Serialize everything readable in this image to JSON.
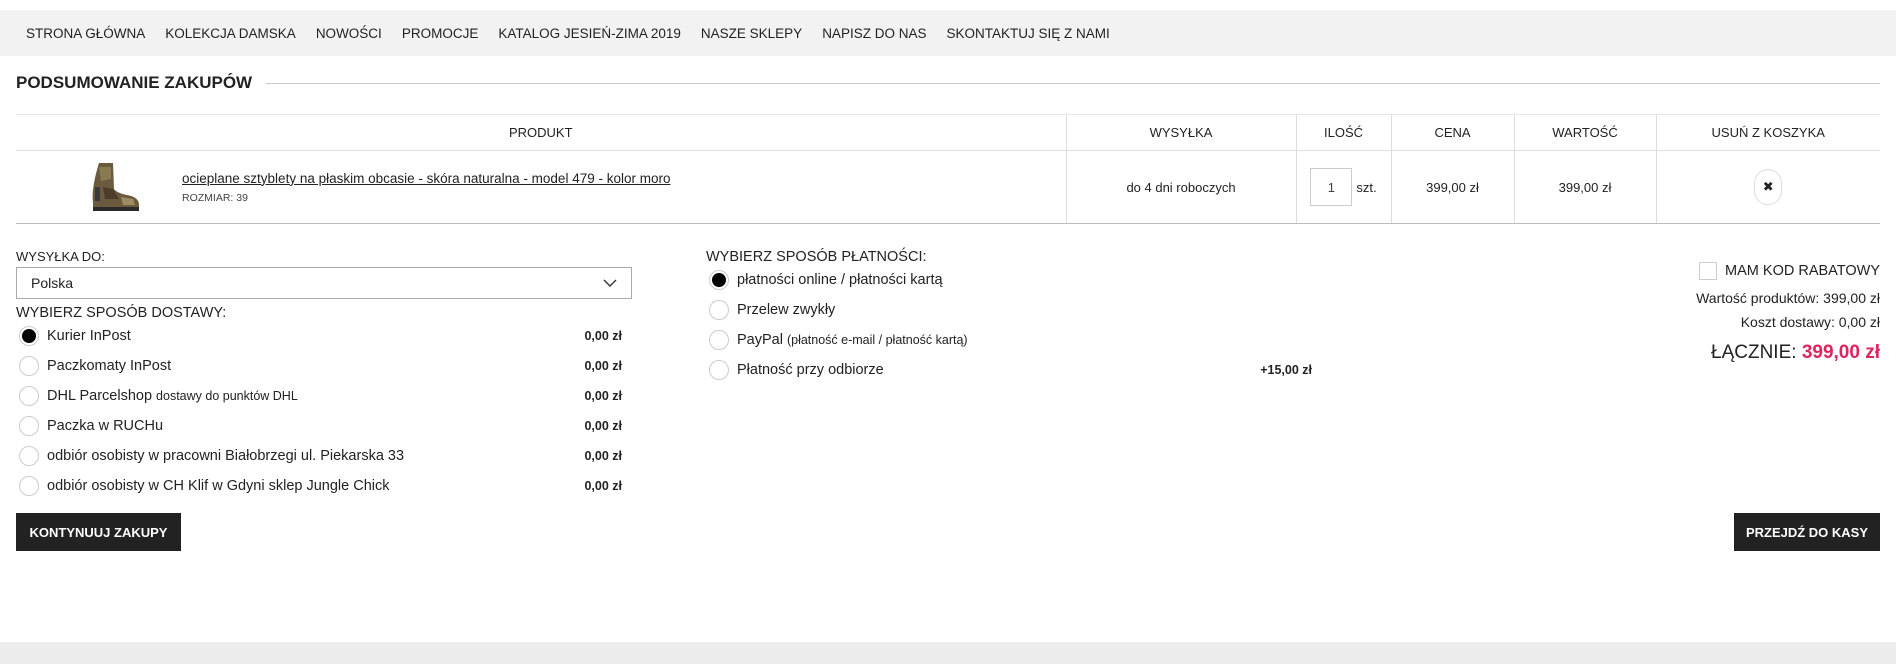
{
  "nav": {
    "items": [
      "STRONA GŁÓWNA",
      "KOLEKCJA DAMSKA",
      "NOWOŚCI",
      "PROMOCJE",
      "KATALOG JESIEŃ-ZIMA 2019",
      "NASZE SKLEPY",
      "NAPISZ DO NAS",
      "SKONTAKTUJ SIĘ Z NAMI"
    ]
  },
  "summary": {
    "title": "PODSUMOWANIE ZAKUPÓW"
  },
  "cart": {
    "headers": {
      "product": "PRODUKT",
      "shipping": "WYSYŁKA",
      "quantity": "ILOŚĆ",
      "price": "CENA",
      "value": "WARTOŚĆ",
      "remove": "USUŃ Z KOSZYKA"
    },
    "item": {
      "name": "ocieplane sztyblety na płaskim obcasie - skóra naturalna - model 479 - kolor moro",
      "size": "ROZMIAR: 39",
      "shipping": "do 4 dni roboczych",
      "quantity": "1",
      "unit": "szt.",
      "price": "399,00 zł",
      "value": "399,00 zł",
      "remove_icon": "close-icon",
      "remove_symbol": "✖"
    }
  },
  "delivery": {
    "ship_to_label": "WYSYŁKA DO:",
    "country": "Polska",
    "method_label": "WYBIERZ SPOSÓB DOSTAWY:",
    "options": [
      {
        "name": "Kurier InPost",
        "sub": "",
        "price": "0,00 zł",
        "checked": true
      },
      {
        "name": "Paczkomaty InPost",
        "sub": "",
        "price": "0,00 zł",
        "checked": false
      },
      {
        "name": "DHL Parcelshop",
        "sub": "dostawy do punktów DHL",
        "price": "0,00 zł",
        "checked": false
      },
      {
        "name": "Paczka w RUCHu",
        "sub": "",
        "price": "0,00 zł",
        "checked": false
      },
      {
        "name": "odbiór osobisty w pracowni Białobrzegi ul. Piekarska 33",
        "sub": "",
        "price": "0,00 zł",
        "checked": false
      },
      {
        "name": "odbiór osobisty w CH Klif w Gdyni sklep Jungle Chick",
        "sub": "",
        "price": "0,00 zł",
        "checked": false
      }
    ]
  },
  "payment": {
    "label": "WYBIERZ SPOSÓB PŁATNOŚCI:",
    "options": [
      {
        "name": "płatności online / płatności kartą",
        "sub": "",
        "price": "",
        "checked": true
      },
      {
        "name": "Przelew zwykły",
        "sub": "",
        "price": "",
        "checked": false
      },
      {
        "name": "PayPal",
        "sub": "(płatność e-mail / płatność kartą)",
        "price": "",
        "checked": false
      },
      {
        "name": "Płatność przy odbiorze",
        "sub": "",
        "price": "+15,00 zł",
        "checked": false
      }
    ]
  },
  "totals": {
    "promo_label": "MAM KOD RABATOWY",
    "products_value": "Wartość produktów: 399,00 zł",
    "shipping_cost": "Koszt dostawy: 0,00 zł",
    "total_label": "ŁĄCZNIE:",
    "total_amount": "399,00 zł"
  },
  "buttons": {
    "continue": "KONTYNUUJ ZAKUPY",
    "checkout": "PRZEJDŹ DO KASY"
  },
  "colors": {
    "accent": "#e0245e",
    "button_bg": "#222222",
    "nav_bg": "#f2f2f2"
  }
}
